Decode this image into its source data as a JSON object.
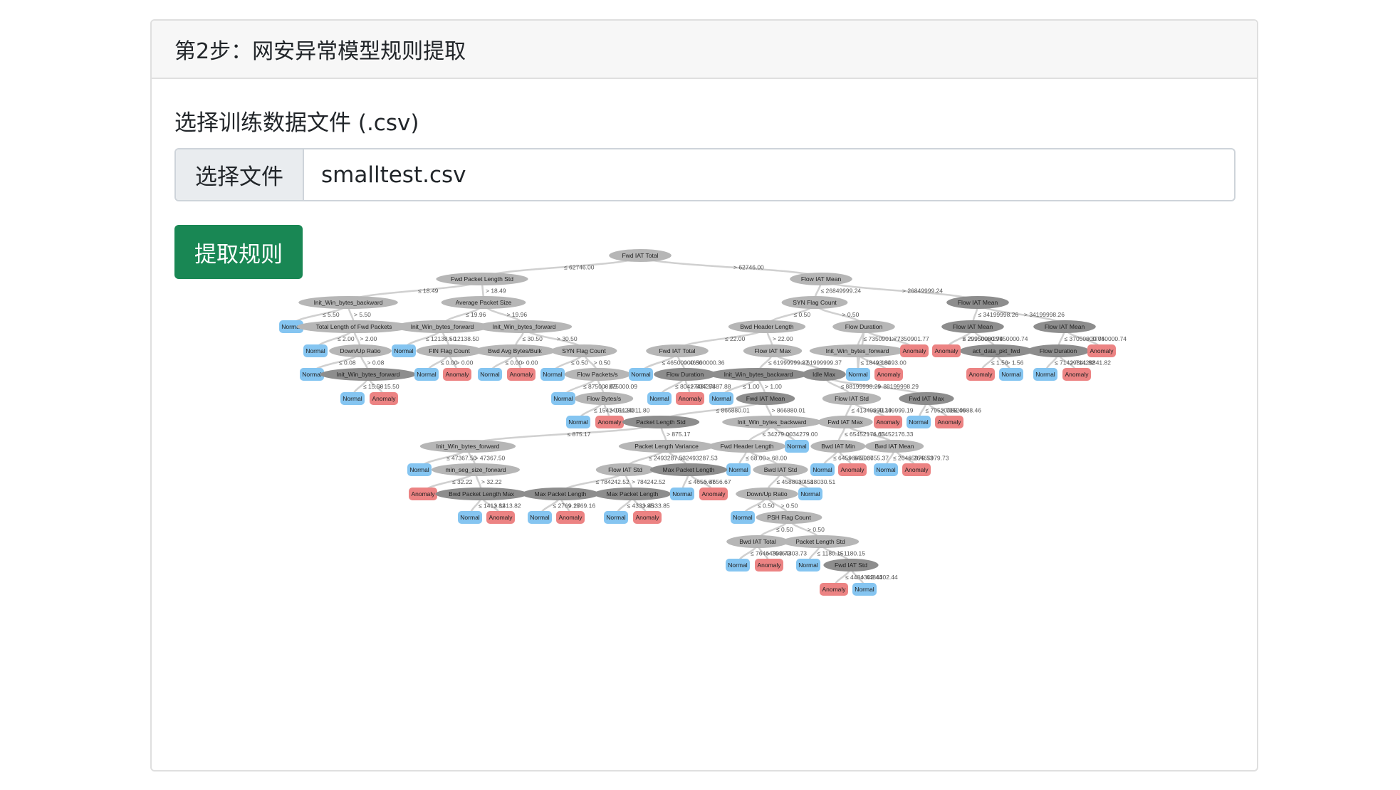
{
  "header": {
    "title": "第2步：网安异常模型规则提取"
  },
  "form": {
    "label": "选择训练数据文件 (.csv)",
    "file_button_label": "选择文件",
    "file_name": "smalltest.csv",
    "submit_label": "提取规则"
  },
  "colors": {
    "normal": "#85c5f1",
    "anomaly": "#ec8383",
    "split_node_light": "#b6b6b6",
    "split_node_dark": "#8d8d8d",
    "edge": "#d0d0d0",
    "button": "#198754"
  },
  "tree": {
    "nodes": [
      {
        "id": "root",
        "type": "split",
        "label": "Fwd IAT Total"
      },
      {
        "id": "a",
        "type": "split",
        "label": "Fwd Packet Length Std",
        "parent": "root",
        "edge": "≤ 62746.00"
      },
      {
        "id": "b",
        "type": "split",
        "label": "Flow IAT Mean",
        "parent": "root",
        "edge": "> 62746.00"
      },
      {
        "id": "a1",
        "type": "split",
        "label": "Init_Win_bytes_backward",
        "parent": "a",
        "edge": "≤ 18.49"
      },
      {
        "id": "a2",
        "type": "split",
        "label": "Average Packet Size",
        "parent": "a",
        "edge": "> 18.49"
      },
      {
        "id": "a1n",
        "type": "leaf",
        "label": "Normal",
        "parent": "a1",
        "edge": "≤ 5.50"
      },
      {
        "id": "a1s",
        "type": "split",
        "label": "Total Length of Fwd Packets",
        "parent": "a1",
        "edge": "> 5.50"
      },
      {
        "id": "a1sn",
        "type": "leaf",
        "label": "Normal",
        "parent": "a1s",
        "edge": "≤ 2.00"
      },
      {
        "id": "a1sd",
        "type": "split",
        "label": "Down/Up Ratio",
        "parent": "a1s",
        "edge": "> 2.00"
      },
      {
        "id": "a1sdn",
        "type": "leaf",
        "label": "Normal",
        "parent": "a1sd",
        "edge": "≤ 0.08"
      },
      {
        "id": "a1sdi",
        "type": "split",
        "label": "Init_Win_bytes_forward",
        "parent": "a1sd",
        "edge": "> 0.08"
      },
      {
        "id": "a1sdin",
        "type": "leaf",
        "label": "Normal",
        "parent": "a1sdi",
        "edge": "≤ 15.50"
      },
      {
        "id": "a1sdia",
        "type": "leaf",
        "label": "Anomaly",
        "parent": "a1sdi",
        "edge": "> 15.50"
      },
      {
        "id": "a2l",
        "type": "split",
        "label": "Init_Win_bytes_forward",
        "parent": "a2",
        "edge": "≤ 19.96"
      },
      {
        "id": "a2r",
        "type": "split",
        "label": "Init_Win_bytes_forward",
        "parent": "a2",
        "edge": "> 19.96"
      },
      {
        "id": "a2ln",
        "type": "leaf",
        "label": "Normal",
        "parent": "a2l",
        "edge": "≤ 12138.50"
      },
      {
        "id": "a2lf",
        "type": "split",
        "label": "FIN Flag Count",
        "parent": "a2l",
        "edge": "> 12138.50"
      },
      {
        "id": "a2lfn",
        "type": "leaf",
        "label": "Normal",
        "parent": "a2lf",
        "edge": "≤ 0.00"
      },
      {
        "id": "a2lfa",
        "type": "leaf",
        "label": "Anomaly",
        "parent": "a2lf",
        "edge": "> 0.00"
      },
      {
        "id": "a2rb",
        "type": "split",
        "label": "Bwd Avg Bytes/Bulk",
        "parent": "a2r",
        "edge": "≤ 30.50"
      },
      {
        "id": "a2rs",
        "type": "split",
        "label": "SYN Flag Count",
        "parent": "a2r",
        "edge": "> 30.50"
      },
      {
        "id": "a2rbn",
        "type": "leaf",
        "label": "Normal",
        "parent": "a2rb",
        "edge": "≤ 0.00"
      },
      {
        "id": "a2rba",
        "type": "leaf",
        "label": "Anomaly",
        "parent": "a2rb",
        "edge": "> 0.00"
      },
      {
        "id": "a2rsn",
        "type": "leaf",
        "label": "Normal",
        "parent": "a2rs",
        "edge": "≤ 0.50"
      },
      {
        "id": "a2rsf",
        "type": "split",
        "label": "Flow Packets/s",
        "parent": "a2rs",
        "edge": "> 0.50"
      },
      {
        "id": "a2rsfn",
        "type": "leaf",
        "label": "Normal",
        "parent": "a2rsf",
        "edge": "≤ 875000.09"
      },
      {
        "id": "a2rsfb",
        "type": "split",
        "label": "Flow Bytes/s",
        "parent": "a2rsf",
        "edge": "> 875000.09"
      },
      {
        "id": "a2rsfbn",
        "type": "leaf",
        "label": "Normal",
        "parent": "a2rsfb",
        "edge": "≤ 15424011.80"
      },
      {
        "id": "a2rsfba",
        "type": "leaf",
        "label": "Anomaly",
        "parent": "a2rsfb",
        "edge": "> 15424011.80"
      },
      {
        "id": "b1",
        "type": "split",
        "label": "SYN Flag Count",
        "parent": "b",
        "edge": "≤ 26849999.24"
      },
      {
        "id": "b2",
        "type": "split",
        "label": "Flow IAT Mean",
        "parent": "b",
        "edge": "> 26849999.24"
      },
      {
        "id": "b1l",
        "type": "split",
        "label": "Bwd Header Length",
        "parent": "b1",
        "edge": "≤ 0.50"
      },
      {
        "id": "b1r",
        "type": "split",
        "label": "Flow Duration",
        "parent": "b1",
        "edge": "> 0.50"
      },
      {
        "id": "c",
        "type": "split",
        "label": "Fwd IAT Total",
        "parent": "b1l",
        "edge": "≤ 22.00"
      },
      {
        "id": "d",
        "type": "split",
        "label": "Flow IAT Max",
        "parent": "b1l",
        "edge": "> 22.00"
      },
      {
        "id": "cn",
        "type": "leaf",
        "label": "Normal",
        "parent": "c",
        "edge": "≤ 46500000.36"
      },
      {
        "id": "cf",
        "type": "split",
        "label": "Flow Duration",
        "parent": "c",
        "edge": "> 46500000.36"
      },
      {
        "id": "cfn",
        "type": "leaf",
        "label": "Normal",
        "parent": "cf",
        "edge": "≤ 80427487.88"
      },
      {
        "id": "cfa",
        "type": "leaf",
        "label": "Anomaly",
        "parent": "cf",
        "edge": "> 80427487.88"
      },
      {
        "id": "di",
        "type": "split",
        "label": "Init_Win_bytes_backward",
        "parent": "d",
        "edge": "≤ 61999999.37"
      },
      {
        "id": "dm",
        "type": "split",
        "label": "Idle Max",
        "parent": "d",
        "edge": "> 61999999.37"
      },
      {
        "id": "din",
        "type": "leaf",
        "label": "Normal",
        "parent": "di",
        "edge": "≤ 1.00"
      },
      {
        "id": "dif",
        "type": "split",
        "label": "Fwd IAT Mean",
        "parent": "di",
        "edge": "> 1.00"
      },
      {
        "id": "dmf",
        "type": "split",
        "label": "Flow IAT Std",
        "parent": "dm",
        "edge": "≤ 88199998.29"
      },
      {
        "id": "dmb",
        "type": "split",
        "label": "Fwd IAT Max",
        "parent": "dm",
        "edge": "> 88199998.29"
      },
      {
        "id": "dmfs",
        "type": "split",
        "label": "Fwd IAT Max",
        "parent": "dmf",
        "edge": "≤ 41349999.19"
      },
      {
        "id": "dmfa",
        "type": "leaf",
        "label": "Anomaly",
        "parent": "dmf",
        "edge": "> 41349999.19"
      },
      {
        "id": "dmbn",
        "type": "leaf",
        "label": "Normal",
        "parent": "dmb",
        "edge": "≤ 79520988.46"
      },
      {
        "id": "dmba",
        "type": "leaf",
        "label": "Anomaly",
        "parent": "dmb",
        "edge": "> 79520988.46"
      },
      {
        "id": "dmfsb",
        "type": "split",
        "label": "Bwd IAT Min",
        "parent": "dmfs",
        "edge": "≤ 65452176.33"
      },
      {
        "id": "dmfsm",
        "type": "split",
        "label": "Bwd IAT Mean",
        "parent": "dmfs",
        "edge": "> 65452176.33"
      },
      {
        "id": "dmfsbn",
        "type": "leaf",
        "label": "Normal",
        "parent": "dmfsb",
        "edge": "≤ 64596655.37"
      },
      {
        "id": "dmfsba",
        "type": "leaf",
        "label": "Anomaly",
        "parent": "dmfsb",
        "edge": "> 64596655.37"
      },
      {
        "id": "dmfsmn",
        "type": "leaf",
        "label": "Normal",
        "parent": "dmfsm",
        "edge": "≤ 26465979.73"
      },
      {
        "id": "dmfsma",
        "type": "leaf",
        "label": "Anomaly",
        "parent": "dmfsm",
        "edge": "> 26465979.73"
      },
      {
        "id": "b1rn",
        "type": "leaf",
        "label": "Normal",
        "parent": "b1r",
        "edge": "≤ 7350901.77"
      },
      {
        "id": "b1ri",
        "type": "split",
        "label": "Init_Win_bytes_forward",
        "parent": "b1r",
        "edge": "≤ 7350901.77"
      },
      {
        "id": "b1ra",
        "type": "leaf",
        "label": "Anomaly",
        "parent": "b1r",
        "edge": "> 7350901.77"
      },
      {
        "id": "b1rin",
        "type": "leaf",
        "label": "Normal",
        "parent": "b1ri",
        "edge": "≤ 18493.00"
      },
      {
        "id": "b1ria",
        "type": "leaf",
        "label": "Anomaly",
        "parent": "b1ri",
        "edge": "> 18493.00"
      },
      {
        "id": "b2l",
        "type": "split",
        "label": "Flow IAT Mean",
        "parent": "b2",
        "edge": "≤ 34199998.26"
      },
      {
        "id": "b2r",
        "type": "split",
        "label": "Flow IAT Mean",
        "parent": "b2",
        "edge": "> 34199998.26"
      },
      {
        "id": "b2la",
        "type": "leaf",
        "label": "Anomaly",
        "parent": "b2l",
        "edge": "≤ 29950000.74"
      },
      {
        "id": "b2lc",
        "type": "split",
        "label": "act_data_pkt_fwd",
        "parent": "b2l",
        "edge": "> 29950000.74"
      },
      {
        "id": "b2lca",
        "type": "leaf",
        "label": "Anomaly",
        "parent": "b2lc",
        "edge": "≤ 1.56"
      },
      {
        "id": "b2lcn",
        "type": "leaf",
        "label": "Normal",
        "parent": "b2lc",
        "edge": "> 1.56"
      },
      {
        "id": "b2rf",
        "type": "split",
        "label": "Flow Duration",
        "parent": "b2r",
        "edge": "≤ 37050000.74"
      },
      {
        "id": "b2ra",
        "type": "leaf",
        "label": "Anomaly",
        "parent": "b2r",
        "edge": "> 37050000.74"
      },
      {
        "id": "b2rfn",
        "type": "leaf",
        "label": "Normal",
        "parent": "b2rf",
        "edge": "≤ 71429841.82"
      },
      {
        "id": "b2rfa",
        "type": "leaf",
        "label": "Anomaly",
        "parent": "b2rf",
        "edge": "> 71429841.82"
      },
      {
        "id": "b2la2",
        "type": "leaf",
        "label": "Anomaly",
        "parent": "b2l",
        "edge": "> 29950000.74"
      },
      {
        "id": "e",
        "type": "split",
        "label": "Init_Win_bytes_backward",
        "parent": "dif",
        "edge": "> 866880.01"
      },
      {
        "id": "f",
        "type": "split",
        "label": "Packet Length Std",
        "parent": "dif",
        "edge": "≤ 866880.01"
      },
      {
        "id": "en",
        "type": "leaf",
        "label": "Normal",
        "parent": "e",
        "edge": "> 34279.00"
      },
      {
        "id": "eh",
        "type": "split",
        "label": "Fwd Header Length",
        "parent": "e",
        "edge": "≤ 34279.00"
      },
      {
        "id": "ehn",
        "type": "leaf",
        "label": "Normal",
        "parent": "eh",
        "edge": "≤ 68.00"
      },
      {
        "id": "ehs",
        "type": "split",
        "label": "Bwd IAT Std",
        "parent": "eh",
        "edge": "> 68.00"
      },
      {
        "id": "ehsd",
        "type": "split",
        "label": "Down/Up Ratio",
        "parent": "ehs",
        "edge": "≤ 4588030.51"
      },
      {
        "id": "ehsn",
        "type": "leaf",
        "label": "Normal",
        "parent": "ehs",
        "edge": "> 4588030.51"
      },
      {
        "id": "ehsdn",
        "type": "leaf",
        "label": "Normal",
        "parent": "ehsd",
        "edge": "≤ 0.50"
      },
      {
        "id": "ehsdp",
        "type": "split",
        "label": "PSH Flag Count",
        "parent": "ehsd",
        "edge": "> 0.50"
      },
      {
        "id": "p1",
        "type": "split",
        "label": "Bwd IAT Total",
        "parent": "ehsdp",
        "edge": "≤ 0.50"
      },
      {
        "id": "p2",
        "type": "split",
        "label": "Packet Length Std",
        "parent": "ehsdp",
        "edge": "> 0.50"
      },
      {
        "id": "p1n",
        "type": "leaf",
        "label": "Normal",
        "parent": "p1",
        "edge": "≤ 76464303.73"
      },
      {
        "id": "p1a",
        "type": "leaf",
        "label": "Anomaly",
        "parent": "p1",
        "edge": "> 76464303.73"
      },
      {
        "id": "p2n",
        "type": "leaf",
        "label": "Normal",
        "parent": "p2",
        "edge": "≤ 1180.15"
      },
      {
        "id": "p2s",
        "type": "split",
        "label": "Fwd IAT Std",
        "parent": "p2",
        "edge": "> 1180.15"
      },
      {
        "id": "p2sa",
        "type": "leaf",
        "label": "Anomaly",
        "parent": "p2s",
        "edge": "≤ 4484302.44"
      },
      {
        "id": "p2sn",
        "type": "leaf",
        "label": "Normal",
        "parent": "p2s",
        "edge": "> 4484302.44"
      },
      {
        "id": "g",
        "type": "split",
        "label": "Init_Win_bytes_forward",
        "parent": "f",
        "edge": "≤ 875.17"
      },
      {
        "id": "h",
        "type": "split",
        "label": "Packet Length Variance",
        "parent": "f",
        "edge": "> 875.17"
      },
      {
        "id": "gn",
        "type": "leaf",
        "label": "Normal",
        "parent": "g",
        "edge": "≤ 47367.50"
      },
      {
        "id": "gm",
        "type": "split",
        "label": "min_seg_size_forward",
        "parent": "g",
        "edge": "> 47367.50"
      },
      {
        "id": "gma",
        "type": "leaf",
        "label": "Anomaly",
        "parent": "gm",
        "edge": "≤ 32.22"
      },
      {
        "id": "gmb",
        "type": "split",
        "label": "Bwd Packet Length Max",
        "parent": "gm",
        "edge": "> 32.22"
      },
      {
        "id": "gmbn",
        "type": "leaf",
        "label": "Normal",
        "parent": "gmb",
        "edge": "≤ 1413.82"
      },
      {
        "id": "gmba",
        "type": "leaf",
        "label": "Anomaly",
        "parent": "gmb",
        "edge": "> 1413.82"
      },
      {
        "id": "hf",
        "type": "split",
        "label": "Flow IAT Std",
        "parent": "h",
        "edge": "≤ 2493287.53"
      },
      {
        "id": "hm",
        "type": "split",
        "label": "Max Packet Length",
        "parent": "h",
        "edge": "> 2493287.53"
      },
      {
        "id": "hfl",
        "type": "split",
        "label": "Max Packet Length",
        "parent": "hf",
        "edge": "≤ 784242.52"
      },
      {
        "id": "hfr",
        "type": "split",
        "label": "Max Packet Length",
        "parent": "hf",
        "edge": "> 784242.52"
      },
      {
        "id": "hfln",
        "type": "leaf",
        "label": "Normal",
        "parent": "hfl",
        "edge": "≤ 2769.16"
      },
      {
        "id": "hfla",
        "type": "leaf",
        "label": "Anomaly",
        "parent": "hfl",
        "edge": "> 2769.16"
      },
      {
        "id": "hfrn",
        "type": "leaf",
        "label": "Normal",
        "parent": "hfr",
        "edge": "≤ 4333.85"
      },
      {
        "id": "hfra",
        "type": "leaf",
        "label": "Anomaly",
        "parent": "hfr",
        "edge": "> 4333.85"
      },
      {
        "id": "hmn",
        "type": "leaf",
        "label": "Normal",
        "parent": "hm",
        "edge": "≤ 4656.67"
      },
      {
        "id": "hma",
        "type": "leaf",
        "label": "Anomaly",
        "parent": "hm",
        "edge": "> 4656.67"
      }
    ]
  }
}
